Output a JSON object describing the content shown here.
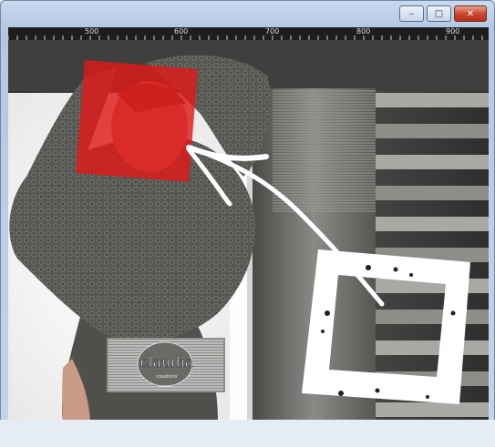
{
  "window": {
    "buttons": {
      "minimize": "–",
      "maximize": "□",
      "close": "✕"
    }
  },
  "ruler": {
    "labels": [
      "500",
      "600",
      "700",
      "800",
      "900"
    ]
  },
  "artwork": {
    "watermark_text": "claudia",
    "watermark_subtext": "creations",
    "selection_color": "#e01919",
    "frame_color": "#ffffff"
  }
}
